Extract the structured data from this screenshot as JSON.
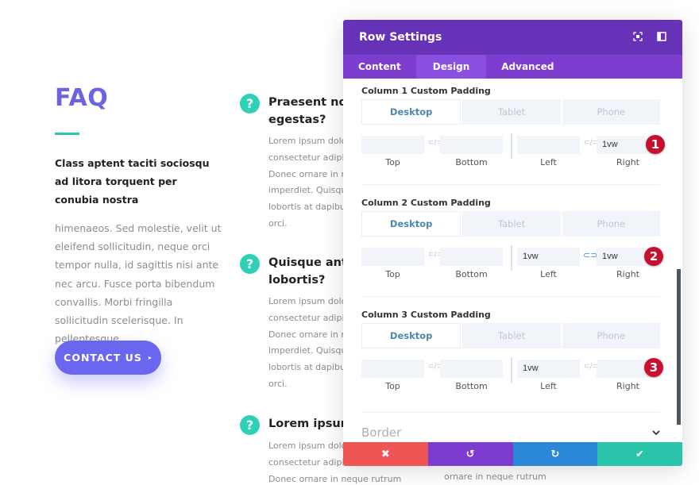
{
  "faq": {
    "title": "FAQ",
    "accent_color": "#2ec5ae",
    "intro": "Class aptent taciti sociosqu ad litora torquent per conubia nostra",
    "body": "himenaeos. Sed molestie, velit ut eleifend sollicitudin, neque orci tempor nulla, id sagittis nisi ante nec arcu. Fusce porta bibendum convallis. Morbi fringilla sollicitudin scelerisque. In pellentesque",
    "contact_button": "CONTACT US",
    "contact_caret": "▸"
  },
  "questions": [
    {
      "icon": "?",
      "title_lines": [
        "Praesent non",
        "egestas?"
      ],
      "body_lines": [
        "Lorem ipsum dolor",
        "consectetur adipisc",
        "Donec ornare in ne",
        "imperdiet. Quisque",
        "lobortis at dapibus",
        "orci."
      ]
    },
    {
      "icon": "?",
      "title_lines": [
        "Quisque ante",
        "lobortis?"
      ],
      "body_lines": [
        "Lorem ipsum dolor",
        "consectetur adipisc",
        "Donec ornare in ne",
        "imperdiet. Quisque",
        "lobortis at dapibus",
        "orci."
      ]
    },
    {
      "icon": "?",
      "title_lines": [
        "Lorem ipsum"
      ],
      "body_lines": [
        "Lorem ipsum dolor",
        "consectetur adipisc",
        "Donec ornare in neque rutrum"
      ],
      "extra_line": "ornare in neque rutrum"
    }
  ],
  "modal": {
    "title": "Row Settings",
    "header_icons": [
      "expand-icon",
      "snap-sidebar-icon"
    ],
    "tabs": [
      {
        "label": "Content",
        "active": false
      },
      {
        "label": "Design",
        "active": true
      },
      {
        "label": "Advanced",
        "active": false
      }
    ],
    "device_tabs": [
      "Desktop",
      "Tablet",
      "Phone"
    ],
    "field_labels": [
      "Top",
      "Bottom",
      "Left",
      "Right"
    ],
    "link_glyph": "⊂/⊃",
    "linked_glyph": "⊂⊃",
    "sections": [
      {
        "label": "Column 1 Custom Padding",
        "values": {
          "top": "",
          "bottom": "",
          "left": "",
          "right": "1vw"
        },
        "lr_linked": false,
        "badge": "1"
      },
      {
        "label": "Column 2 Custom Padding",
        "values": {
          "top": "",
          "bottom": "",
          "left": "1vw",
          "right": "1vw"
        },
        "lr_linked": true,
        "badge": "2"
      },
      {
        "label": "Column 3 Custom Padding",
        "values": {
          "top": "",
          "bottom": "",
          "left": "1vw",
          "right": ""
        },
        "lr_linked": false,
        "badge": "3"
      }
    ],
    "border_label": "Border",
    "border_chevron": "⌄",
    "footer": {
      "cancel": "✖",
      "undo": "↺",
      "redo": "↻",
      "save": "✔"
    },
    "colors": {
      "header": "#6633b8",
      "tabs": "#7d3ed0",
      "cancel": "#ef5555",
      "undo": "#7e3bd0",
      "redo": "#2b87da",
      "save": "#29c4a9",
      "badge": "#c8102e"
    }
  }
}
